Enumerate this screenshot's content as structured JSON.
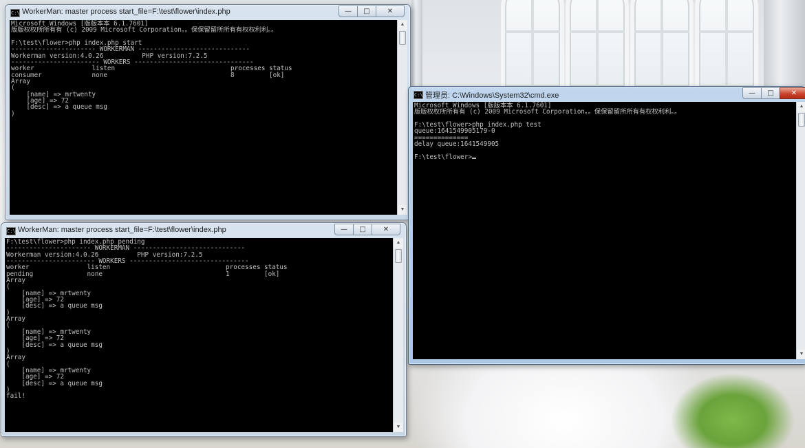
{
  "windows": [
    {
      "id": "start",
      "title": "WorkerMan: master process  start_file=F:\\test\\flower\\index.php",
      "icon": "console-icon",
      "controls": {
        "minimize": "—",
        "maximize": "□",
        "close": "✕"
      },
      "lines": [
        "Microsoft Windows [版版本本 6.1.7601]",
        "版版权权所所有有 (c) 2009 Microsoft Corporation。。保保留留所所有有权权利利。。",
        "",
        "F:\\test\\flower>php index.php start",
        "---------------------- WORKERMAN -----------------------------",
        "Workerman version:4.0.26          PHP version:7.2.5",
        "----------------------- WORKERS -------------------------------",
        "worker               listen                              processes status",
        "consumer             none                                8         [ok]",
        "Array",
        "(",
        "    [name] => mrtwenty",
        "    [age] => 72",
        "    [desc] => a queue msg",
        ")"
      ]
    },
    {
      "id": "pending",
      "title": "WorkerMan: master process  start_file=F:\\test\\flower\\index.php",
      "icon": "console-icon",
      "controls": {
        "minimize": "—",
        "maximize": "□",
        "close": "✕"
      },
      "lines": [
        "F:\\test\\flower>php index.php pending",
        "---------------------- WORKERMAN -----------------------------",
        "Workerman version:4.0.26          PHP version:7.2.5",
        "----------------------- WORKERS -------------------------------",
        "worker               listen                              processes status",
        "pending              none                                1         [ok]",
        "Array",
        "(",
        "    [name] => mrtwenty",
        "    [age] => 72",
        "    [desc] => a queue msg",
        ")",
        "Array",
        "(",
        "    [name] => mrtwenty",
        "    [age] => 72",
        "    [desc] => a queue msg",
        ")",
        "Array",
        "(",
        "    [name] => mrtwenty",
        "    [age] => 72",
        "    [desc] => a queue msg",
        ")",
        "fail!"
      ]
    },
    {
      "id": "cmd",
      "title": "管理员: C:\\Windows\\System32\\cmd.exe",
      "icon": "console-icon",
      "controls": {
        "minimize": "—",
        "maximize": "□",
        "close": "✕"
      },
      "lines": [
        "Microsoft Windows [版版本本 6.1.7601]",
        "版版权权所所有有 (c) 2009 Microsoft Corporation。。保保留留所所有有权权利利。。",
        "",
        "F:\\test\\flower>php index.php test",
        "queue:1641549905179-0",
        "==============",
        "delay queue:1641549905",
        "",
        "F:\\test\\flower>"
      ]
    }
  ],
  "icon_glyph": "C:\\",
  "colors": {
    "console_bg": "#000000",
    "console_fg": "#c0c0c0",
    "titlebar_active": "#a8c6e4",
    "close_active": "#c9452d"
  }
}
